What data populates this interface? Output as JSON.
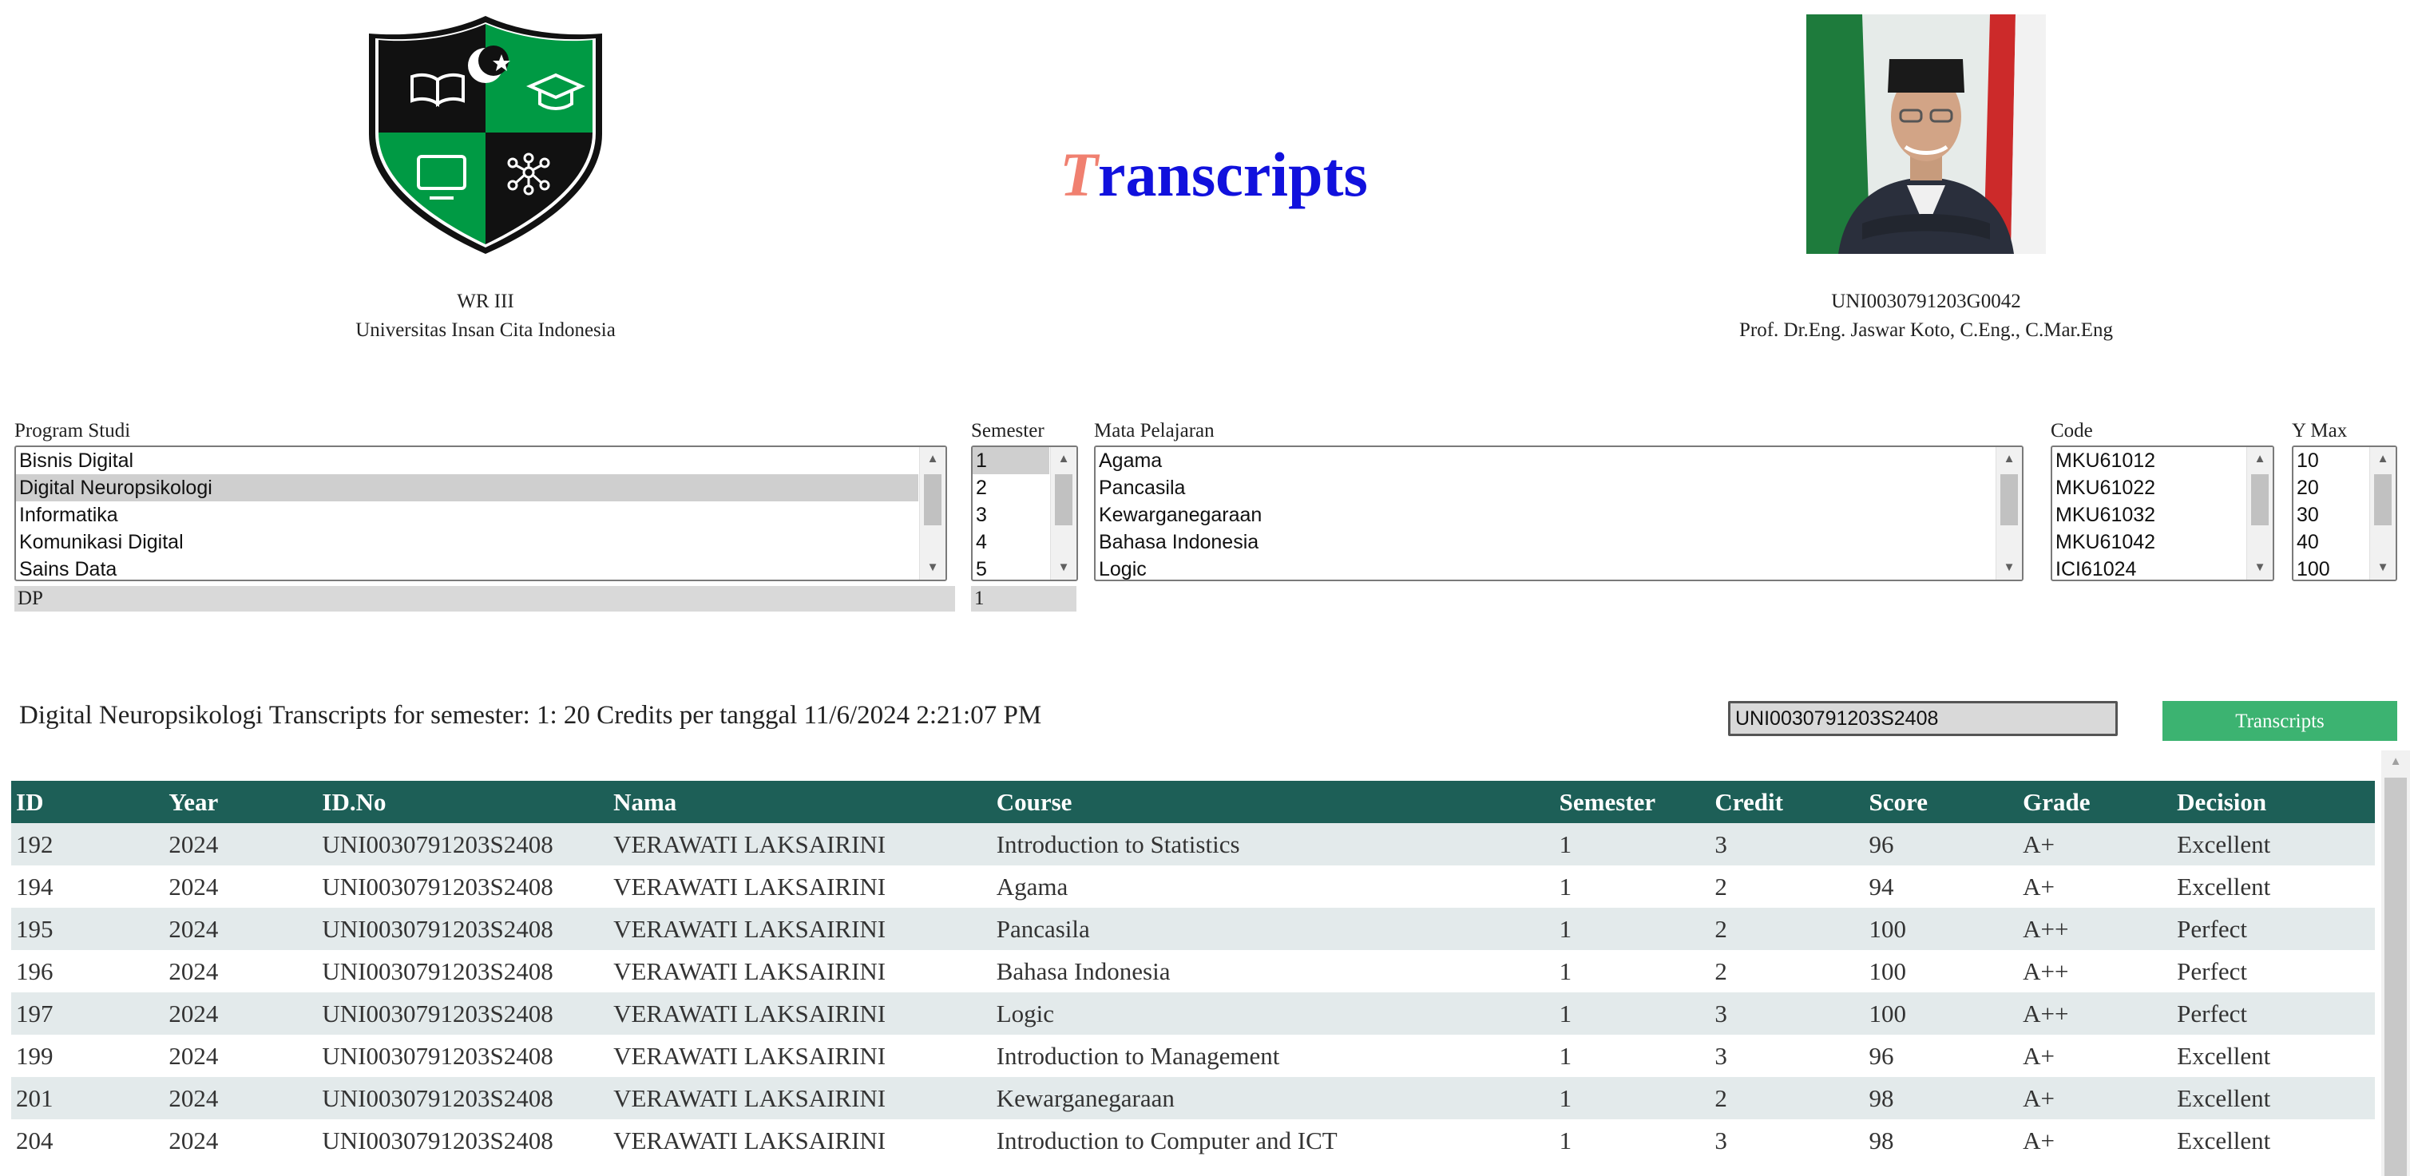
{
  "header": {
    "left_caption_line1": "WR III",
    "left_caption_line2": "Universitas Insan Cita Indonesia",
    "title_first_letter": "T",
    "title_rest": "ranscripts",
    "right_caption_line1": "UNI0030791203G0042",
    "right_caption_line2": "Prof. Dr.Eng. Jaswar Koto, C.Eng., C.Mar.Eng"
  },
  "filters": {
    "program": {
      "label": "Program Studi",
      "options": [
        "Bisnis Digital",
        "Digital Neuropsikologi",
        "Informatika",
        "Komunikasi Digital",
        "Sains Data"
      ],
      "selected_index": 1,
      "readout": "DP"
    },
    "semester": {
      "label": "Semester",
      "options": [
        "1",
        "2",
        "3",
        "4",
        "5"
      ],
      "selected_index": 0,
      "readout": "1"
    },
    "course": {
      "label": "Mata Pelajaran",
      "options": [
        "Agama",
        "Pancasila",
        "Kewarganegaraan",
        "Bahasa Indonesia",
        "Logic"
      ],
      "selected_index": -1
    },
    "code": {
      "label": "Code",
      "options": [
        "MKU61012",
        "MKU61022",
        "MKU61032",
        "MKU61042",
        "ICI61024"
      ],
      "selected_index": -1
    },
    "ymax": {
      "label": "Y Max",
      "options": [
        "10",
        "20",
        "30",
        "40",
        "100"
      ],
      "selected_index": -1
    }
  },
  "report": {
    "summary": "Digital Neuropsikologi Transcripts for semester: 1: 20 Credits per tanggal 11/6/2024 2:21:07 PM",
    "student_id_value": "UNI0030791203S2408",
    "button_label": "Transcripts"
  },
  "table": {
    "columns": [
      "ID",
      "Year",
      "ID.No",
      "Nama",
      "Course",
      "Semester",
      "Credit",
      "Score",
      "Grade",
      "Decision"
    ],
    "rows": [
      [
        "192",
        "2024",
        "UNI0030791203S2408",
        "VERAWATI LAKSAIRINI",
        "Introduction to Statistics",
        "1",
        "3",
        "96",
        "A+",
        "Excellent"
      ],
      [
        "194",
        "2024",
        "UNI0030791203S2408",
        "VERAWATI LAKSAIRINI",
        "Agama",
        "1",
        "2",
        "94",
        "A+",
        "Excellent"
      ],
      [
        "195",
        "2024",
        "UNI0030791203S2408",
        "VERAWATI LAKSAIRINI",
        "Pancasila",
        "1",
        "2",
        "100",
        "A++",
        "Perfect"
      ],
      [
        "196",
        "2024",
        "UNI0030791203S2408",
        "VERAWATI LAKSAIRINI",
        "Bahasa Indonesia",
        "1",
        "2",
        "100",
        "A++",
        "Perfect"
      ],
      [
        "197",
        "2024",
        "UNI0030791203S2408",
        "VERAWATI LAKSAIRINI",
        "Logic",
        "1",
        "3",
        "100",
        "A++",
        "Perfect"
      ],
      [
        "199",
        "2024",
        "UNI0030791203S2408",
        "VERAWATI LAKSAIRINI",
        "Introduction to Management",
        "1",
        "3",
        "96",
        "A+",
        "Excellent"
      ],
      [
        "201",
        "2024",
        "UNI0030791203S2408",
        "VERAWATI LAKSAIRINI",
        "Kewarganegaraan",
        "1",
        "2",
        "98",
        "A+",
        "Excellent"
      ],
      [
        "204",
        "2024",
        "UNI0030791203S2408",
        "VERAWATI LAKSAIRINI",
        "Introduction to Computer and ICT",
        "1",
        "3",
        "98",
        "A+",
        "Excellent"
      ]
    ]
  },
  "colors": {
    "table_header": "#1d5f57",
    "row_alt": "#e3eaeb",
    "button": "#3cb371",
    "title_first": "#f08070",
    "title_rest": "#1111dd",
    "crest_green": "#009a44"
  },
  "icons": [
    "university-crest-logo",
    "book-icon",
    "graduation-cap-icon",
    "monitor-icon",
    "network-icon",
    "crescent-star-icon",
    "portrait-photo"
  ]
}
